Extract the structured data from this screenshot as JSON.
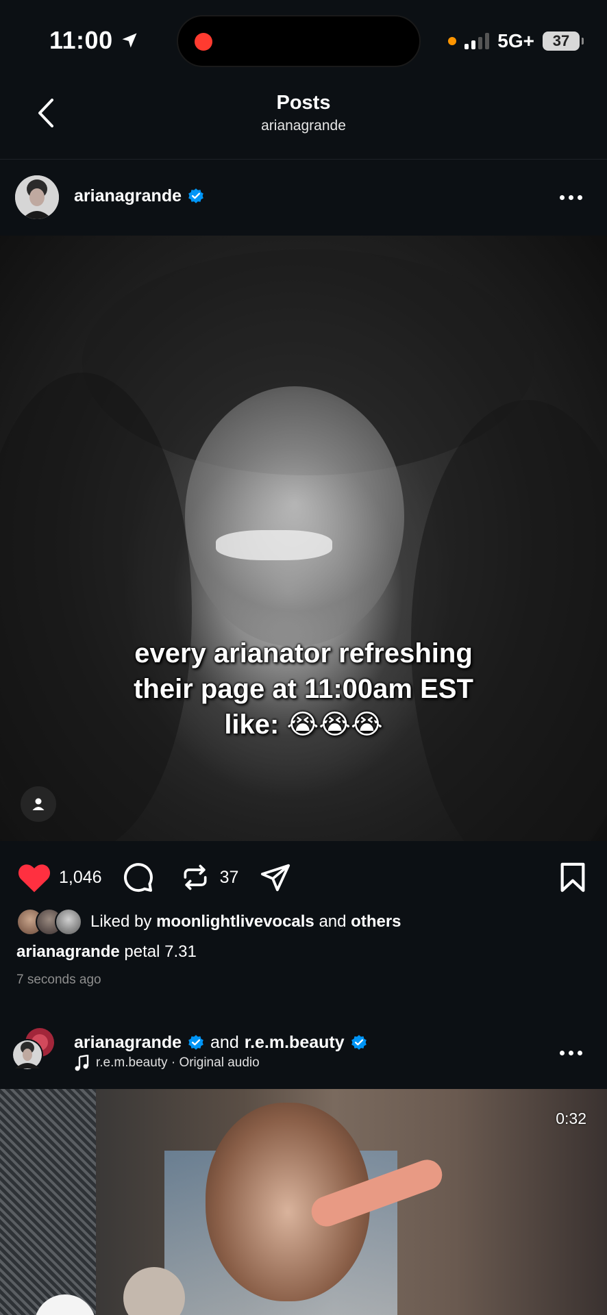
{
  "status_bar": {
    "time": "11:00",
    "network": "5G+",
    "battery": "37"
  },
  "header": {
    "title": "Posts",
    "subtitle": "arianagrande"
  },
  "post1": {
    "author": "arianagrande",
    "image_caption_lines": [
      "every arianator refreshing",
      "their page at 11:00am EST",
      "like: 😭😭😭"
    ],
    "likes": "1,046",
    "reposts": "37",
    "liked_by_prefix": "Liked by",
    "liked_by_user": "moonlightlivevocals",
    "liked_by_and": "and",
    "liked_by_others": "others",
    "caption_author": "arianagrande",
    "caption_text": "petal 7.31",
    "time_ago": "7 seconds ago"
  },
  "post2": {
    "author": "arianagrande",
    "and_text": "and",
    "collaborator": "r.e.m.beauty",
    "audio": "r.e.m.beauty · Original audio",
    "video_time": "0:32"
  },
  "colors": {
    "background": "#0c1014",
    "verified": "#0095f6",
    "like": "#ff3040"
  }
}
